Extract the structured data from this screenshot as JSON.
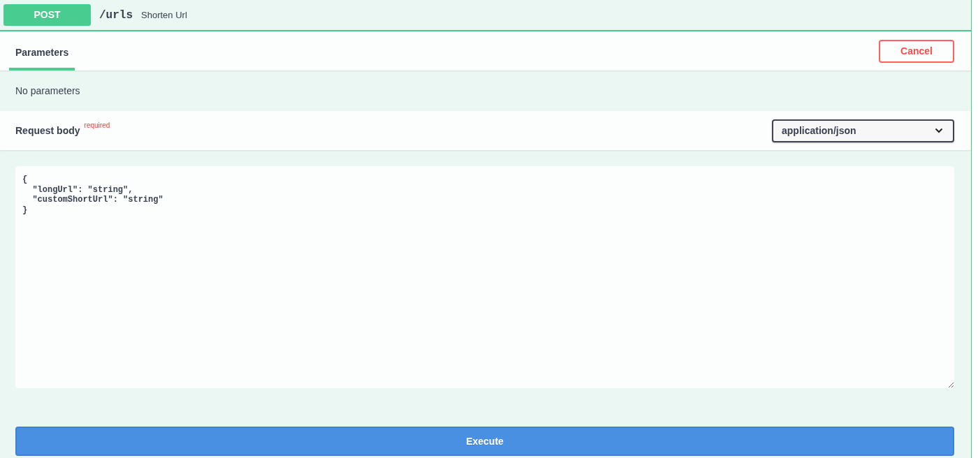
{
  "operation": {
    "method": "POST",
    "path": "/urls",
    "summary": "Shorten Url"
  },
  "tabs": [
    {
      "label": "Parameters",
      "selected": true
    }
  ],
  "cancel_button": "Cancel",
  "parameters": {
    "message": "No parameters"
  },
  "request_body": {
    "title": "Request body",
    "required_label": "required",
    "content_type": "application/json",
    "value": "{\n  \"longUrl\": \"string\",\n  \"customShortUrl\": \"string\"\n}"
  },
  "execute_button": "Execute"
}
